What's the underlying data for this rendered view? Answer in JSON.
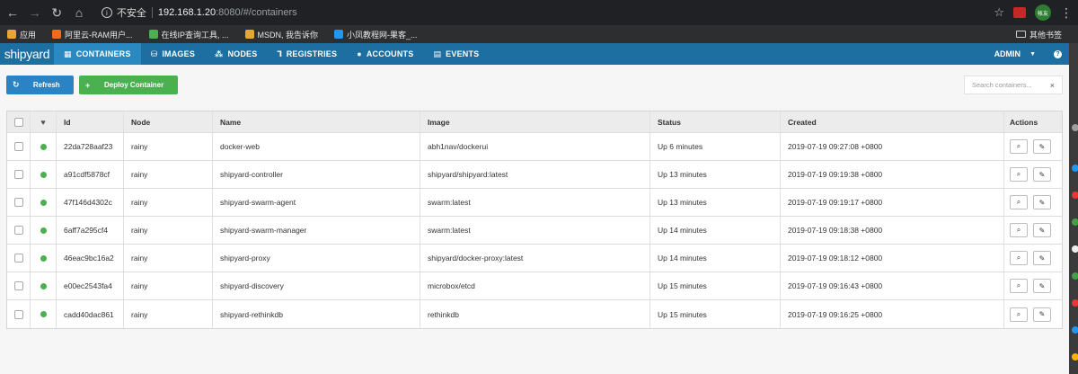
{
  "browser": {
    "insecure_label": "不安全",
    "url_host": "192.168.1.20",
    "url_path": ":8080/#/containers",
    "ext_green_label": "帐友",
    "bookmarks": [
      {
        "label": "应用",
        "color": "#e8a33b"
      },
      {
        "label": "阿里云-RAM用户...",
        "color": "#f26b1d"
      },
      {
        "label": "在线IP查询工具, ...",
        "color": "#4caf50"
      },
      {
        "label": "MSDN, 我告诉你",
        "color": "#e8a33b"
      },
      {
        "label": "小凤教程网-果客_...",
        "color": "#2196f3"
      }
    ],
    "other_bookmarks": "其他书签"
  },
  "nav": {
    "logo": "shipyard",
    "items": [
      {
        "label": "CONTAINERS",
        "icon": "▦",
        "active": true
      },
      {
        "label": "IMAGES",
        "icon": "⛁",
        "active": false
      },
      {
        "label": "NODES",
        "icon": "⁂",
        "active": false
      },
      {
        "label": "REGISTRIES",
        "icon": "⅂",
        "active": false
      },
      {
        "label": "ACCOUNTS",
        "icon": "●",
        "active": false
      },
      {
        "label": "EVENTS",
        "icon": "▤",
        "active": false
      }
    ],
    "user": "ADMIN"
  },
  "toolbar": {
    "refresh_label": "Refresh",
    "deploy_label": "Deploy Container",
    "search_placeholder": "Search containers..."
  },
  "table": {
    "columns": [
      "Id",
      "Node",
      "Name",
      "Image",
      "Status",
      "Created",
      "Actions"
    ],
    "rows": [
      {
        "id": "22da728aaf23",
        "node": "rainy",
        "name": "docker-web",
        "image": "abh1nav/dockerui",
        "status": "Up 6 minutes",
        "created": "2019-07-19 09:27:08 +0800"
      },
      {
        "id": "a91cdf5878cf",
        "node": "rainy",
        "name": "shipyard-controller",
        "image": "shipyard/shipyard:latest",
        "status": "Up 13 minutes",
        "created": "2019-07-19 09:19:38 +0800"
      },
      {
        "id": "47f146d4302c",
        "node": "rainy",
        "name": "shipyard-swarm-agent",
        "image": "swarm:latest",
        "status": "Up 13 minutes",
        "created": "2019-07-19 09:19:17 +0800"
      },
      {
        "id": "6aff7a295cf4",
        "node": "rainy",
        "name": "shipyard-swarm-manager",
        "image": "swarm:latest",
        "status": "Up 14 minutes",
        "created": "2019-07-19 09:18:38 +0800"
      },
      {
        "id": "46eac9bc16a2",
        "node": "rainy",
        "name": "shipyard-proxy",
        "image": "shipyard/docker-proxy:latest",
        "status": "Up 14 minutes",
        "created": "2019-07-19 09:18:12 +0800"
      },
      {
        "id": "e00ec2543fa4",
        "node": "rainy",
        "name": "shipyard-discovery",
        "image": "microbox/etcd",
        "status": "Up 15 minutes",
        "created": "2019-07-19 09:16:43 +0800"
      },
      {
        "id": "cadd40dac861",
        "node": "rainy",
        "name": "shipyard-rethinkdb",
        "image": "rethinkdb",
        "status": "Up 15 minutes",
        "created": "2019-07-19 09:16:25 +0800"
      }
    ]
  },
  "colors": {
    "nav_bg": "#1c6fa0",
    "nav_active": "#2a89c1",
    "refresh": "#2b83c4",
    "deploy": "#4bb04f",
    "status_running": "#4bb04f"
  }
}
